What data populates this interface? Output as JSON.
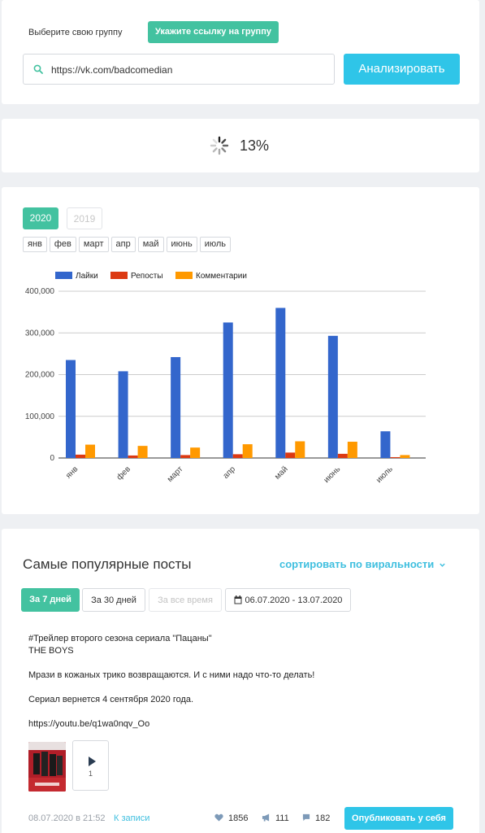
{
  "group": {
    "label": "Выберите свою группу",
    "link_button": "Укажите ссылку на группу",
    "url_value": "https://vk.com/badcomedian",
    "analyze_button": "Анализировать"
  },
  "progress": {
    "value_text": "13%",
    "value": 0.13
  },
  "stats": {
    "years": [
      "2020",
      "2019"
    ],
    "months": [
      "янв",
      "фев",
      "март",
      "апр",
      "май",
      "июнь",
      "июль"
    ]
  },
  "chart_data": {
    "type": "bar",
    "categories": [
      "янв",
      "фев",
      "март",
      "апр",
      "май",
      "июнь",
      "июль"
    ],
    "series": [
      {
        "name": "Лайки",
        "color": "#3366cc",
        "values": [
          235000,
          208000,
          242000,
          325000,
          360000,
          293000,
          64000
        ]
      },
      {
        "name": "Репосты",
        "color": "#dc3912",
        "values": [
          8000,
          6000,
          7000,
          9000,
          13000,
          10000,
          2000
        ]
      },
      {
        "name": "Комментарии",
        "color": "#ff9900",
        "values": [
          32000,
          29000,
          25000,
          33000,
          40000,
          39000,
          7000
        ]
      }
    ],
    "yticks": [
      "0",
      "100,000",
      "200,000",
      "300,000",
      "400,000"
    ],
    "ylim": [
      0,
      400000
    ],
    "grid": true,
    "legend_position": "top-left"
  },
  "popular": {
    "title": "Самые популярные посты",
    "sort_label": "сортировать по виральности",
    "filters": {
      "week": "За 7 дней",
      "month": "За 30 дней",
      "all": "За все время",
      "range": "06.07.2020 - 13.07.2020"
    },
    "post": {
      "lines": [
        "#Трейлер второго сезона сериала \"Пацаны\"",
        "THE BOYS",
        "",
        "Мрази в кожаных трико возвращаются. И с ними надо что-то делать!",
        "",
        "Сериал вернется 4 сентября 2020 года.",
        "",
        "https://youtu.be/q1wa0nqv_Oo"
      ],
      "video_count": "1",
      "date": "08.07.2020 в 21:52",
      "to_post": "К записи",
      "likes": "1856",
      "reposts": "111",
      "comments": "182",
      "publish_button": "Опубликовать у себя"
    }
  }
}
